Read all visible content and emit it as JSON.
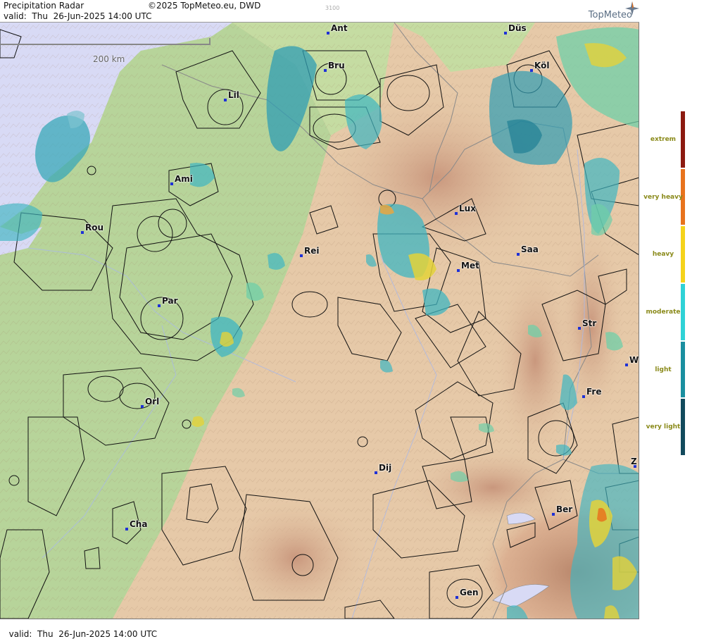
{
  "header": {
    "title": "Precipitation Radar",
    "copyright": "©2025 TopMeteo.eu, DWD",
    "valid": "valid:  Thu  26-Jun-2025 14:00 UTC",
    "code": "3100",
    "brand": "TopMeteo"
  },
  "footer": {
    "valid": "valid:  Thu  26-Jun-2025 14:00 UTC"
  },
  "scale": {
    "label": "200 km"
  },
  "colors": {
    "sea": "#d8daf5",
    "lowland": "#b7d49a",
    "upland": "#e6c9a8",
    "mountain": "#d7a88e",
    "border": "#8a8a8a",
    "airspace": "#111111",
    "city_dot": "#1f31d6"
  },
  "cities": [
    {
      "name": "Ant"
    },
    {
      "name": "Düs"
    },
    {
      "name": "Bru"
    },
    {
      "name": "Köl"
    },
    {
      "name": "Lil"
    },
    {
      "name": "Ami"
    },
    {
      "name": "Rou"
    },
    {
      "name": "Lux"
    },
    {
      "name": "Rei"
    },
    {
      "name": "Saa"
    },
    {
      "name": "Met"
    },
    {
      "name": "Par"
    },
    {
      "name": "Str"
    },
    {
      "name": "W"
    },
    {
      "name": "Fre"
    },
    {
      "name": "Orl"
    },
    {
      "name": "Dij"
    },
    {
      "name": "Z"
    },
    {
      "name": "Ber"
    },
    {
      "name": "Cha"
    },
    {
      "name": "Gen"
    }
  ],
  "legend": {
    "items": [
      {
        "label": "extrem",
        "color": "#8c1a10"
      },
      {
        "label": "very heavy",
        "color": "#e8731d"
      },
      {
        "label": "heavy",
        "color": "#f5d31b"
      },
      {
        "label": "moderate",
        "color": "#2fd2d6"
      },
      {
        "label": "light",
        "color": "#1a8fa0"
      },
      {
        "label": "very light",
        "color": "#124a5c"
      }
    ]
  }
}
